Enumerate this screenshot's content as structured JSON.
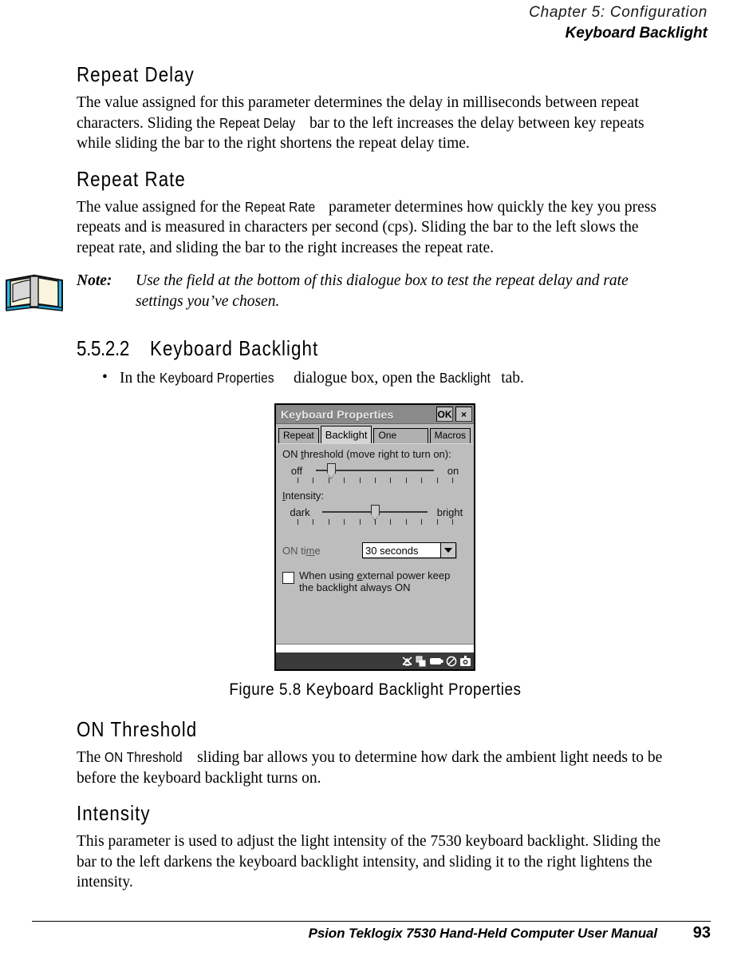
{
  "header": {
    "chapter": "Chapter  5:  Configuration",
    "section": "Keyboard Backlight"
  },
  "sections": [
    {
      "heading": "Repeat Delay",
      "paragraph_parts": [
        "The value assigned for this parameter determines the delay in milliseconds between repeat characters. Sliding the ",
        "Repeat Delay",
        " bar to the left increases the delay between key repeats while sliding the bar to the right shortens the repeat delay time."
      ]
    },
    {
      "heading": "Repeat Rate",
      "paragraph_parts": [
        "The value assigned for the ",
        "Repeat Rate",
        " parameter determines how quickly the key you press repeats and is measured in characters per second (cps). Sliding the bar to the left slows the repeat rate, and sliding the bar to the right increases the repeat rate."
      ]
    }
  ],
  "note": {
    "icon": "open-book-icon",
    "label": "Note:",
    "text": "Use the field at the bottom of this dialogue box to test the repeat delay and rate settings you’ve chosen."
  },
  "numbered_section": {
    "number": "5.5.2.2",
    "title": "Keyboard Backlight",
    "bullet": {
      "marker": "•",
      "parts": [
        "In the ",
        "Keyboard Properties",
        " dialogue box, open the ",
        "Backlight",
        " tab."
      ]
    }
  },
  "dialog": {
    "title": "Keyboard Properties",
    "titlebar_buttons": [
      {
        "label": "OK",
        "name": "ok-button"
      },
      {
        "label": "×",
        "name": "close-button"
      }
    ],
    "tabs": [
      {
        "label": "Repeat",
        "active": false
      },
      {
        "label": "Backlight",
        "active": true
      },
      {
        "label": "One Shots",
        "active": false
      },
      {
        "label": "Macros",
        "active": false
      }
    ],
    "on_threshold": {
      "label_prefix": "ON ",
      "label_underline": "t",
      "label_suffix": "hreshold (move right to turn on):",
      "left_label": "off",
      "right_label": "on",
      "value_percent": 13,
      "tick_count": 11
    },
    "intensity": {
      "label_underline": "I",
      "label_suffix": "ntensity:",
      "left_label": "dark",
      "right_label": "bright",
      "value_percent": 50,
      "tick_count": 11
    },
    "on_time": {
      "label_prefix": "ON ti",
      "label_underline": "m",
      "label_suffix": "e",
      "selected_value": "30 seconds"
    },
    "checkbox": {
      "checked": false,
      "text_line1_prefix": "When using ",
      "text_line1_underline": "e",
      "text_line1_suffix": "xternal power keep",
      "text_line2": "the backlight always ON"
    },
    "taskbar_icons": [
      "no-antenna-icon",
      "windows-tasks-icon",
      "battery-icon",
      "no-sound-icon",
      "settings-icon"
    ],
    "colors": {
      "titlebar": "#8a8a8a",
      "panel": "#bdbdbd",
      "active_tab": "#d4d4d4",
      "taskbar": "#3a3a3a"
    }
  },
  "figure_caption": "Figure 5.8 Keyboard Backlight Properties",
  "sections_after": [
    {
      "heading": "ON Threshold",
      "paragraph_parts": [
        "The ",
        "ON Threshold",
        " sliding bar allows you to determine how dark the ambient light needs to be before the keyboard backlight turns on."
      ]
    },
    {
      "heading": "Intensity",
      "paragraph_parts": [
        "This parameter is used to adjust the light intensity of the 7530 keyboard backlight. Sliding the bar to the left darkens the keyboard backlight intensity, and sliding it to the right lightens the intensity.",
        "",
        ""
      ]
    }
  ],
  "footer": {
    "text": "Psion Teklogix 7530 Hand-Held Computer User Manual",
    "page": "93"
  }
}
